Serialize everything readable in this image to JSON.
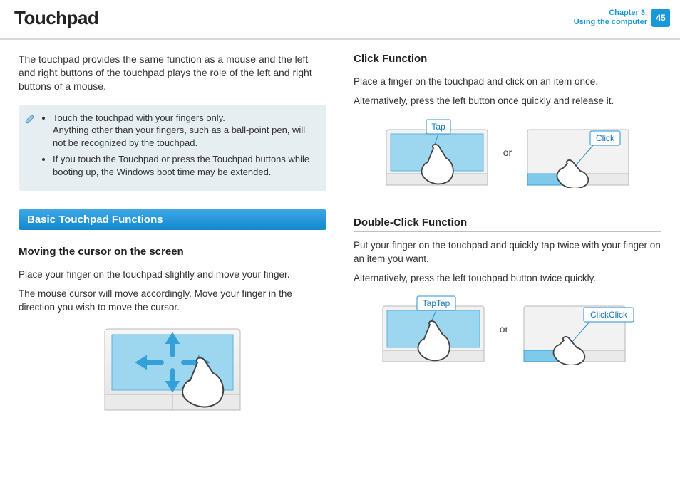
{
  "header": {
    "title": "Touchpad",
    "chapter_line1": "Chapter 3.",
    "chapter_line2": "Using the computer",
    "page_number": "45"
  },
  "left": {
    "intro": "The touchpad provides the same function as a mouse and the left and right buttons of the touchpad plays the role of the left and right buttons of a mouse.",
    "notes": {
      "item1_line1": "Touch the touchpad with your fingers only.",
      "item1_line2": "Anything other than your fingers, such as a ball-point pen, will not be recognized by the touchpad.",
      "item2": "If you touch the Touchpad or press the Touchpad buttons while booting up, the Windows boot time may be extended."
    },
    "section_bar": "Basic Touchpad Functions",
    "moving": {
      "heading": "Moving the cursor on the screen",
      "p1": "Place your finger on the touchpad slightly and move your finger.",
      "p2": "The mouse cursor will move accordingly. Move your finger in the direction you wish to move the cursor."
    }
  },
  "right": {
    "click": {
      "heading": "Click Function",
      "p1": "Place a finger on the touchpad and click on an item once.",
      "p2": "Alternatively, press the left button once quickly and release it.",
      "tap_label": "Tap",
      "click_label": "Click",
      "or": "or"
    },
    "dclick": {
      "heading": "Double-Click Function",
      "p1": "Put your finger on the touchpad and quickly tap twice with your finger on an item you want.",
      "p2": "Alternatively, press the left touchpad button twice quickly.",
      "tap_label": "TapTap",
      "click_label": "ClickClick",
      "or": "or"
    }
  }
}
